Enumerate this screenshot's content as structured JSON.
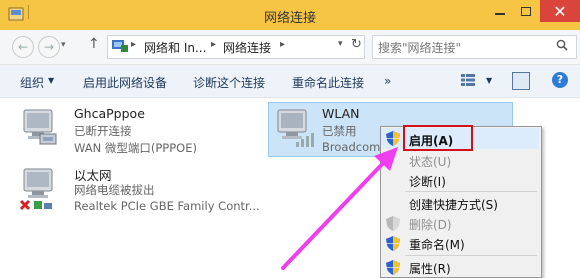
{
  "window": {
    "title": "网络连接",
    "close_glyph": "✕"
  },
  "nav": {
    "back_glyph": "←",
    "forward_glyph": "→",
    "up_glyph": "↑",
    "dropdown_glyph": "▾",
    "refresh_glyph": "↻",
    "breadcrumbs": [
      "网络和 In...",
      "网络连接"
    ],
    "crumb_sep": "▸",
    "search_placeholder": "搜索\"网络连接\""
  },
  "toolbar": {
    "organize": "组织",
    "disable_device": "启用此网络设备",
    "diagnose": "诊断这个连接",
    "rename": "重命名此连接",
    "more": "»",
    "drop_glyph": "▼",
    "help_glyph": "?"
  },
  "connections": [
    {
      "name": "GhcaPppoe",
      "status": "已断开连接",
      "device": "WAN 微型端口(PPPOE)"
    },
    {
      "name": "WLAN",
      "status": "已禁用",
      "device": "Broadcom"
    },
    {
      "name": "以太网",
      "status": "网络电缆被拔出",
      "device": "Realtek PCIe GBE Family Contr..."
    }
  ],
  "context_menu": {
    "items": [
      {
        "label": "启用(A)",
        "icon": "shield-icon",
        "bold": true,
        "disabled": false
      },
      {
        "label": "状态(U)",
        "icon": "",
        "bold": false,
        "disabled": true
      },
      {
        "label": "诊断(I)",
        "icon": "",
        "bold": false,
        "disabled": false
      },
      {
        "label": "创建快捷方式(S)",
        "icon": "",
        "bold": false,
        "disabled": false
      },
      {
        "label": "删除(D)",
        "icon": "shield-icon",
        "bold": false,
        "disabled": true
      },
      {
        "label": "重命名(M)",
        "icon": "shield-icon",
        "bold": false,
        "disabled": false
      },
      {
        "label": "属性(R)",
        "icon": "shield-icon",
        "bold": false,
        "disabled": false
      }
    ]
  },
  "colors": {
    "title_bar": "#f6c544",
    "close_button": "#d9453b",
    "highlight": "#cce4f7",
    "annotation_box": "#d0111b",
    "annotation_arrow": "#f03df0"
  }
}
